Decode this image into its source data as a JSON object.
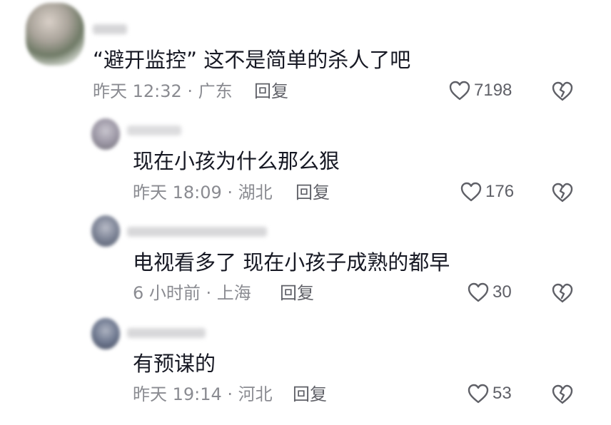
{
  "comments": [
    {
      "text": "“避开监控” 这不是简单的杀人了吧",
      "meta": "昨天 12:32 · 广东",
      "reply_label": "回复",
      "likes": "7198"
    },
    {
      "text": "现在小孩为什么那么狠",
      "meta": "昨天 18:09 · 湖北",
      "reply_label": "回复",
      "likes": "176"
    },
    {
      "text": "电视看多了 现在小孩子成熟的都早",
      "meta": "6 小时前 · 上海",
      "reply_label": "回复",
      "likes": "30"
    },
    {
      "text": "有预谋的",
      "meta": "昨天 19:14 · 河北",
      "reply_label": "回复",
      "likes": "53"
    }
  ],
  "colors": {
    "text": "#161823",
    "meta": "#8a8b91",
    "action": "#5f6067"
  },
  "icons": {
    "like": "heart-outline-icon",
    "dislike": "broken-heart-icon"
  }
}
